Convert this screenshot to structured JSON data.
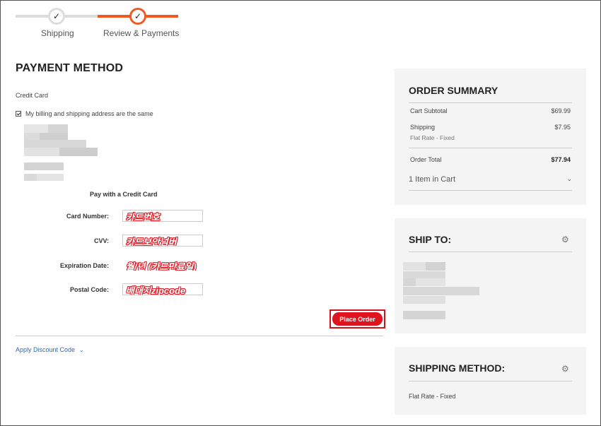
{
  "progress": {
    "steps": [
      {
        "label": "Shipping",
        "status": "complete"
      },
      {
        "label": "Review & Payments",
        "status": "current"
      }
    ],
    "check_glyph": "✓"
  },
  "payment": {
    "title": "PAYMENT METHOD",
    "method_label": "Credit Card",
    "same_address_label": "My billing and shipping address are the same",
    "same_address_checked": true,
    "form_title": "Pay with a Credit Card",
    "fields": {
      "card_number": {
        "label": "Card Number:",
        "value": "카드번호"
      },
      "cvv": {
        "label": "CVV:",
        "value": "카드보안넘버"
      },
      "expiration": {
        "label": "Expiration Date:",
        "value": "월/년 (카드만료일)"
      },
      "postal": {
        "label": "Postal Code:",
        "value": "배대지zipcode"
      }
    },
    "place_order_label": "Place Order",
    "discount_label": "Apply Discount Code",
    "discount_chevron": "⌄"
  },
  "summary": {
    "title": "ORDER SUMMARY",
    "cart_subtotal_label": "Cart Subtotal",
    "cart_subtotal_value": "$69.99",
    "shipping_label": "Shipping",
    "shipping_value": "$7.95",
    "shipping_method": "Flat Rate - Fixed",
    "order_total_label": "Order Total",
    "order_total_value": "$77.94",
    "items_label": "1 Item in Cart",
    "items_chevron": "⌄"
  },
  "ship_to": {
    "title": "SHIP TO:",
    "gear_glyph": "⚙"
  },
  "shipping_method": {
    "title": "SHIPPING METHOD:",
    "value": "Flat Rate - Fixed",
    "gear_glyph": "⚙"
  },
  "colors": {
    "accent": "#ef5a23",
    "button": "#e0141f",
    "link": "#2a6ab6"
  }
}
